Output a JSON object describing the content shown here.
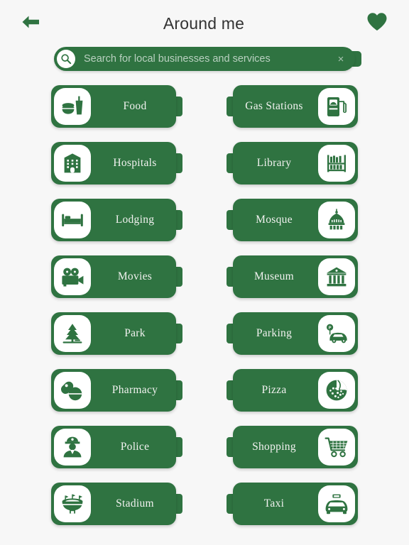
{
  "theme": {
    "accent": "#2f7341",
    "background": "#f7f7f7",
    "title_color": "#333333",
    "card_label_color": "#f2f2f0",
    "icon_plate_color": "#ffffff"
  },
  "header": {
    "title": "Around me",
    "back_icon": "arrow-left-icon",
    "favorite_icon": "heart-icon"
  },
  "search": {
    "placeholder": "Search for local businesses and services",
    "value": "",
    "icon": "search-icon",
    "clear_label": "×"
  },
  "categories": [
    {
      "label": "Food",
      "icon": "food-icon",
      "side": "left"
    },
    {
      "label": "Gas Stations",
      "icon": "gas-pump-icon",
      "side": "right"
    },
    {
      "label": "Hospitals",
      "icon": "hospital-icon",
      "side": "left"
    },
    {
      "label": "Library",
      "icon": "library-icon",
      "side": "right"
    },
    {
      "label": "Lodging",
      "icon": "bed-icon",
      "side": "left"
    },
    {
      "label": "Mosque",
      "icon": "mosque-icon",
      "side": "right"
    },
    {
      "label": "Movies",
      "icon": "movie-camera-icon",
      "side": "left"
    },
    {
      "label": "Museum",
      "icon": "museum-icon",
      "side": "right"
    },
    {
      "label": "Park",
      "icon": "tree-icon",
      "side": "left"
    },
    {
      "label": "Parking",
      "icon": "parking-car-icon",
      "side": "right"
    },
    {
      "label": "Pharmacy",
      "icon": "pill-icon",
      "side": "left"
    },
    {
      "label": "Pizza",
      "icon": "pizza-icon",
      "side": "right"
    },
    {
      "label": "Police",
      "icon": "police-icon",
      "side": "left"
    },
    {
      "label": "Shopping",
      "icon": "cart-icon",
      "side": "right"
    },
    {
      "label": "Stadium",
      "icon": "stadium-icon",
      "side": "left"
    },
    {
      "label": "Taxi",
      "icon": "taxi-icon",
      "side": "right"
    }
  ]
}
